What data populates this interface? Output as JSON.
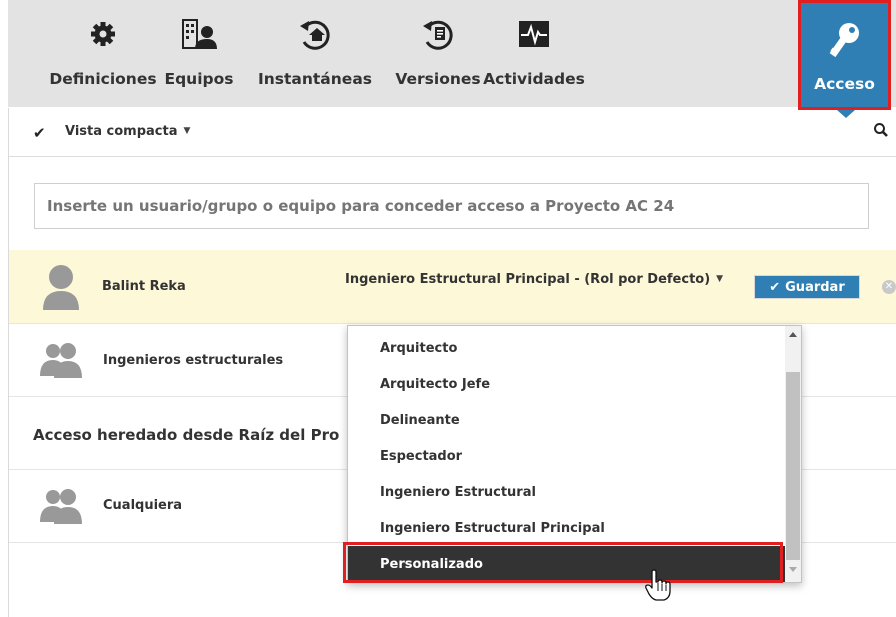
{
  "toolbar": {
    "items": [
      {
        "label": "Definiciones",
        "icon": "gear-icon"
      },
      {
        "label": "Equipos",
        "icon": "building-user-icon"
      },
      {
        "label": "Instantáneas",
        "icon": "snapshot-icon"
      },
      {
        "label": "Versiones",
        "icon": "version-icon"
      },
      {
        "label": "Actividades",
        "icon": "activity-icon"
      }
    ],
    "access": {
      "label": "Acceso",
      "icon": "key-icon",
      "color": "#2f7fb5"
    }
  },
  "view": {
    "label": "Vista compacta"
  },
  "user_input": {
    "placeholder": "Inserte un usuario/grupo o equipo para conceder acceso a Proyecto AC 24"
  },
  "rows": [
    {
      "name": "Balint Reka",
      "role": "Ingeniero Estructural Principal - (Rol por Defecto)",
      "save_label": "Guardar"
    },
    {
      "name": "Ingenieros estructurales"
    }
  ],
  "inherited_label": "Acceso heredado desde Raíz del Pro",
  "inherited_rows": [
    {
      "name": "Cualquiera"
    }
  ],
  "role_dropdown": {
    "options": [
      "Arquitecto",
      "Arquitecto Jefe",
      "Delineante",
      "Espectador",
      "Ingeniero Estructural",
      "Ingeniero Estructural Principal",
      "Personalizado"
    ],
    "selected": "Personalizado"
  },
  "colors": {
    "accent": "#2f7fb5",
    "highlight_row": "#fdf8d8",
    "selection": "#333333",
    "callout": "#e02020"
  }
}
